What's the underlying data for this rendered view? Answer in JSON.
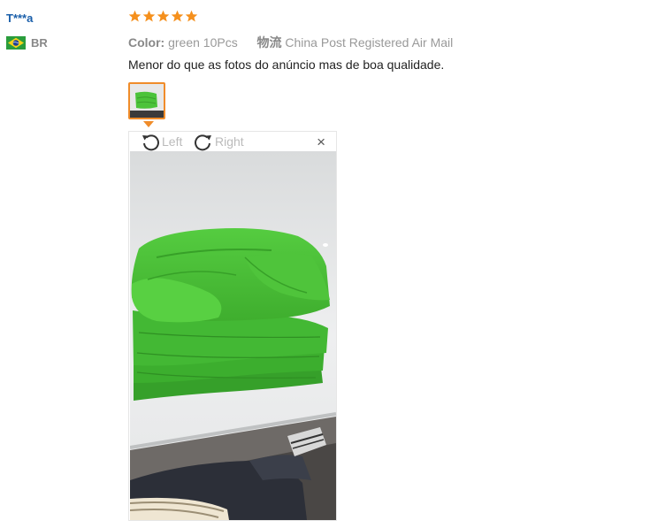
{
  "review": {
    "user": "T***a",
    "country_code": "BR",
    "rating": 5,
    "color_label": "Color:",
    "color_value": "green 10Pcs",
    "shipping_label": "物流",
    "shipping_value": "China Post Registered Air Mail",
    "text": "Menor do que as fotos do anúncio mas de boa qualidade."
  },
  "viewer": {
    "rotate_left_label": "Left",
    "rotate_right_label": "Right",
    "close_label": "×"
  },
  "colors": {
    "accent": "#f08c2a",
    "star": "#f5901d",
    "username": "#1a5faa",
    "towel_green": "#4cc33a"
  },
  "icons": [
    "star-icon",
    "brazil-flag-icon",
    "rotate-left-icon",
    "rotate-right-icon",
    "close-icon"
  ]
}
